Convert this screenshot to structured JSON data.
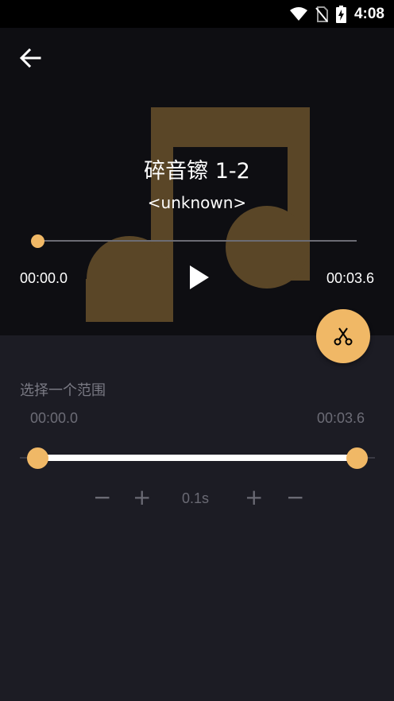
{
  "status_bar": {
    "time": "4:08"
  },
  "track": {
    "title": "碎音镲 1-2",
    "artist": "<unknown>"
  },
  "player": {
    "current_time": "00:00.0",
    "total_time": "00:03.6",
    "progress": 0
  },
  "range": {
    "label": "选择一个范围",
    "start": "00:00.0",
    "end": "00:03.6",
    "start_fraction": 0,
    "end_fraction": 1
  },
  "step": {
    "value": "0.1s",
    "start_decrease": "−",
    "start_increase": "+",
    "end_increase": "+",
    "end_decrease": "−"
  },
  "colors": {
    "accent": "#f0b866",
    "background": "#1c1c24",
    "player_bg": "#0e0e12"
  },
  "icons": [
    "wifi-icon",
    "no-sim-icon",
    "battery-charging-icon",
    "back-arrow-icon",
    "music-note-icon",
    "play-icon",
    "scissors-icon"
  ]
}
